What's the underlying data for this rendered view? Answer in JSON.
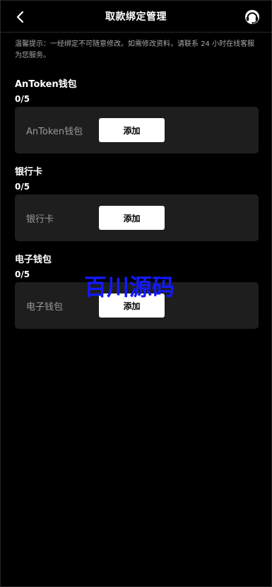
{
  "header": {
    "title": "取款绑定管理",
    "back_icon": "chevron-left-icon",
    "support_icon": "headset-icon"
  },
  "notice": "温馨提示：一经绑定不可随意修改。如需修改资料，请联系 24 小时在线客服为您服务。",
  "sections": [
    {
      "title": "AnToken钱包",
      "count": "0/5",
      "card_label": "AnToken钱包",
      "button_label": "添加"
    },
    {
      "title": "银行卡",
      "count": "0/5",
      "card_label": "银行卡",
      "button_label": "添加"
    },
    {
      "title": "电子钱包",
      "count": "0/5",
      "card_label": "电子钱包",
      "button_label": "添加"
    }
  ],
  "watermark": "百川源码",
  "colors": {
    "background": "#000000",
    "card": "#1e1e1e",
    "button": "#ffffff",
    "watermark": "#1219ff"
  }
}
